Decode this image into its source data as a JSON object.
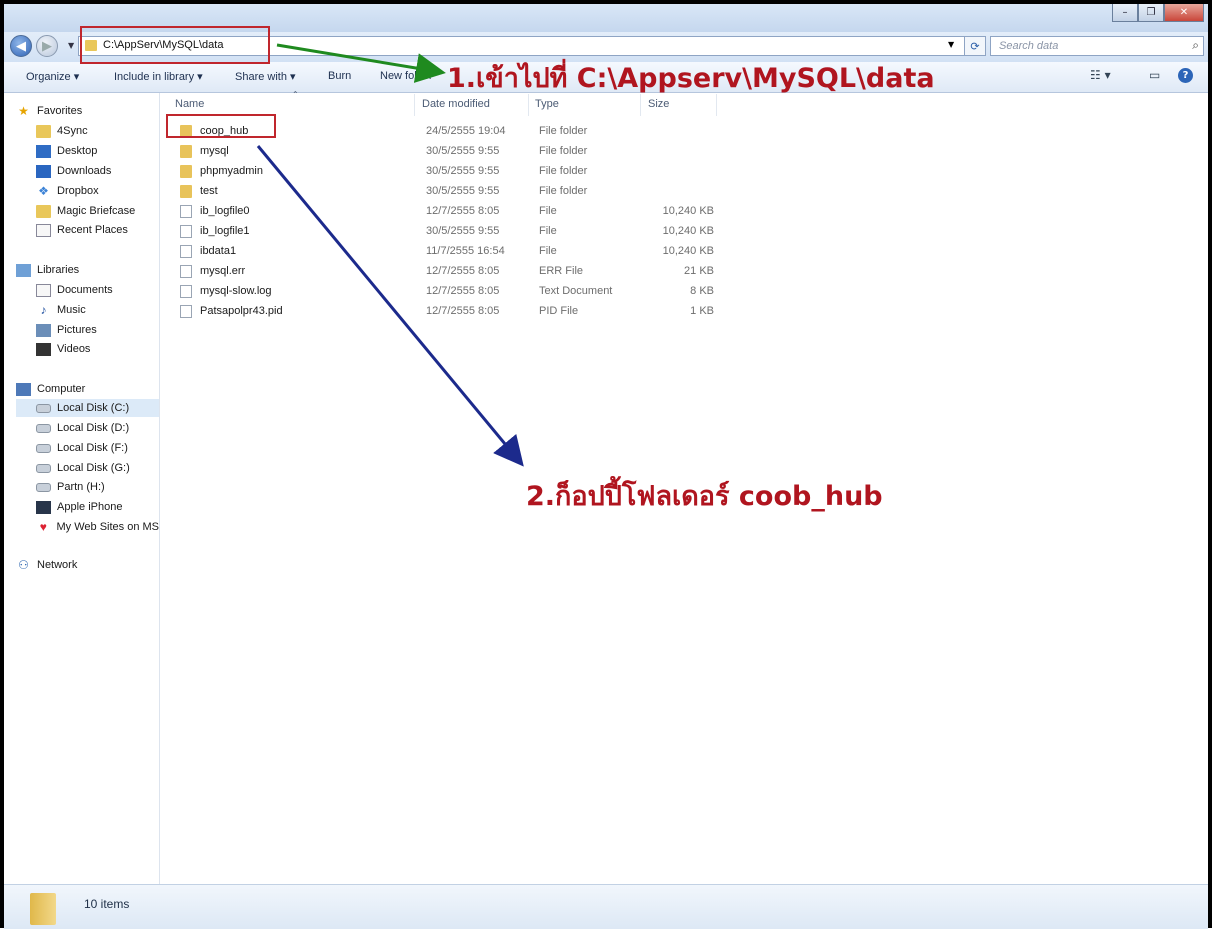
{
  "window": {
    "controls": {
      "minimize": "–",
      "maximize": "❐",
      "close": "✕"
    }
  },
  "address": {
    "path": "C:\\AppServ\\MySQL\\data",
    "search_placeholder": "Search data"
  },
  "toolbar": {
    "organize": "Organize ▾",
    "include": "Include in library ▾",
    "share": "Share with ▾",
    "burn": "Burn",
    "new_folder": "New folder"
  },
  "sidebar": {
    "favorites": {
      "title": "Favorites",
      "items": [
        {
          "label": "4Sync",
          "icon": "4sync-icon"
        },
        {
          "label": "Desktop",
          "icon": "desktop-icon"
        },
        {
          "label": "Downloads",
          "icon": "downloads-icon"
        },
        {
          "label": "Dropbox",
          "icon": "dropbox-icon"
        },
        {
          "label": "Magic Briefcase",
          "icon": "briefcase-icon"
        },
        {
          "label": "Recent Places",
          "icon": "recent-places-icon"
        }
      ]
    },
    "libraries": {
      "title": "Libraries",
      "items": [
        {
          "label": "Documents"
        },
        {
          "label": "Music"
        },
        {
          "label": "Pictures"
        },
        {
          "label": "Videos"
        }
      ]
    },
    "computer": {
      "title": "Computer",
      "items": [
        {
          "label": "Local Disk (C:)",
          "selected": true
        },
        {
          "label": "Local Disk (D:)"
        },
        {
          "label": "Local Disk (F:)"
        },
        {
          "label": "Local Disk (G:)"
        },
        {
          "label": "Partn (H:)"
        },
        {
          "label": "Apple iPhone"
        },
        {
          "label": "My Web Sites on MS"
        }
      ]
    },
    "network": {
      "title": "Network"
    }
  },
  "columns": {
    "name": "Name",
    "date": "Date modified",
    "type": "Type",
    "size": "Size"
  },
  "files": [
    {
      "name": "coop_hub",
      "date": "24/5/2555 19:04",
      "type": "File folder",
      "size": "",
      "kind": "folder"
    },
    {
      "name": "mysql",
      "date": "30/5/2555 9:55",
      "type": "File folder",
      "size": "",
      "kind": "folder"
    },
    {
      "name": "phpmyadmin",
      "date": "30/5/2555 9:55",
      "type": "File folder",
      "size": "",
      "kind": "folder"
    },
    {
      "name": "test",
      "date": "30/5/2555 9:55",
      "type": "File folder",
      "size": "",
      "kind": "folder"
    },
    {
      "name": "ib_logfile0",
      "date": "12/7/2555 8:05",
      "type": "File",
      "size": "10,240 KB",
      "kind": "file"
    },
    {
      "name": "ib_logfile1",
      "date": "30/5/2555 9:55",
      "type": "File",
      "size": "10,240 KB",
      "kind": "file"
    },
    {
      "name": "ibdata1",
      "date": "11/7/2555 16:54",
      "type": "File",
      "size": "10,240 KB",
      "kind": "file"
    },
    {
      "name": "mysql.err",
      "date": "12/7/2555 8:05",
      "type": "ERR File",
      "size": "21 KB",
      "kind": "file"
    },
    {
      "name": "mysql-slow.log",
      "date": "12/7/2555 8:05",
      "type": "Text Document",
      "size": "8 KB",
      "kind": "file"
    },
    {
      "name": "Patsapolpr43.pid",
      "date": "12/7/2555 8:05",
      "type": "PID File",
      "size": "1 KB",
      "kind": "file"
    }
  ],
  "status": {
    "count": "10 items"
  },
  "annotations": {
    "step1": "1.เข้าไปที่ C:\\Appserv\\MySQL\\data",
    "step2": "2.ก็อปปี้โฟลเดอร์ coob_hub",
    "colors": {
      "box": "#c0262d",
      "text": "#b0151f",
      "arrow1": "#1f8a1f",
      "arrow2": "#1c2a8c"
    }
  }
}
